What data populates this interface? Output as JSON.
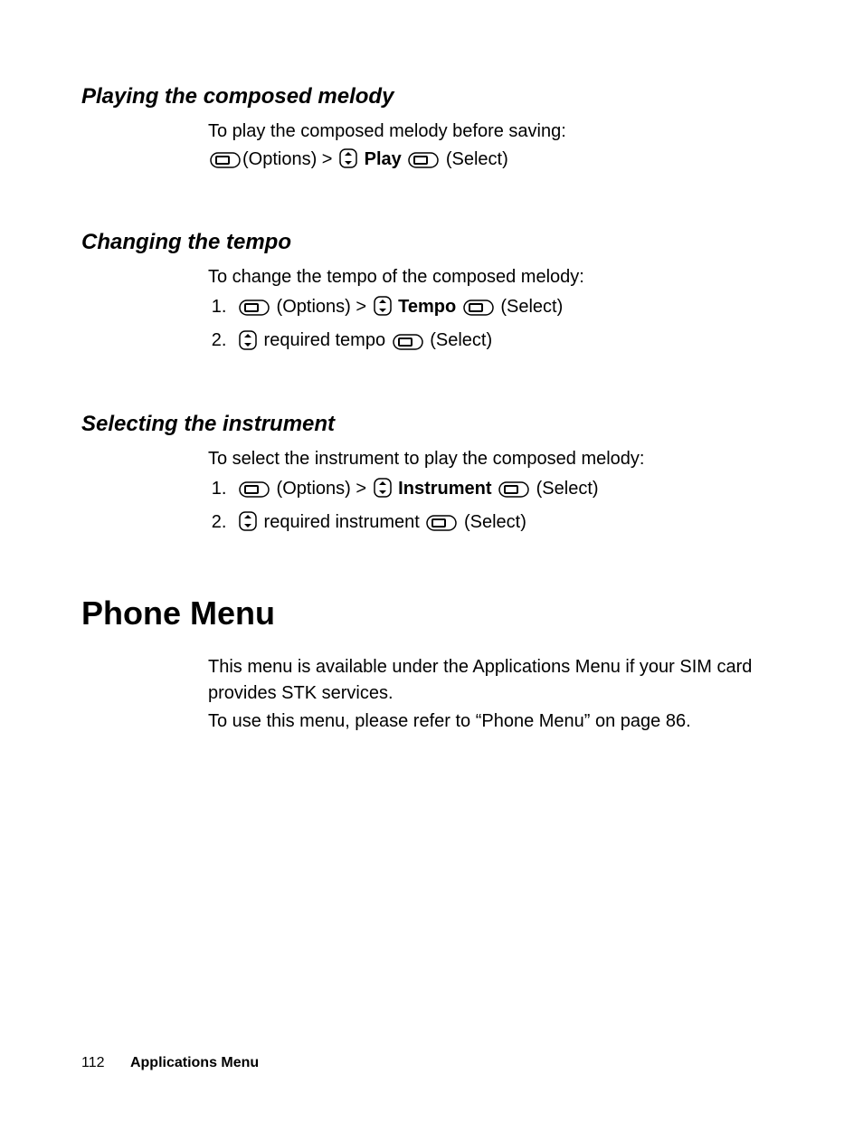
{
  "sections": {
    "playing": {
      "heading": "Playing the composed melody",
      "intro": "To play the composed melody before saving:",
      "line_options": "(Options) > ",
      "play_label": "Play ",
      "select_label": " (Select)"
    },
    "tempo": {
      "heading": "Changing the tempo",
      "intro": "To change the tempo of the composed melody:",
      "step1_options": " (Options) > ",
      "step1_tempo": "Tempo ",
      "step1_select": " (Select)",
      "step2_text": " required tempo ",
      "step2_select": " (Select)"
    },
    "instrument": {
      "heading": "Selecting the instrument",
      "intro": "To select the instrument to play the composed melody:",
      "step1_options": " (Options) > ",
      "step1_instrument": "Instrument ",
      "step1_select": " (Select)",
      "step2_text": " required instrument ",
      "step2_select": " (Select)"
    },
    "phone_menu": {
      "heading": "Phone Menu",
      "para1": "This menu is available under the Applications Menu if your SIM card provides STK services.",
      "para2": "To use this menu, please refer to “Phone Menu” on page 86."
    }
  },
  "footer": {
    "page_number": "112",
    "section_name": "Applications Menu"
  }
}
